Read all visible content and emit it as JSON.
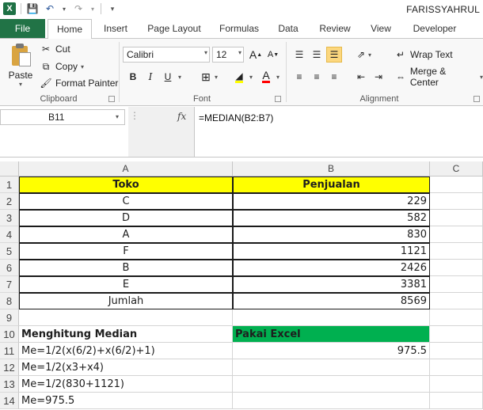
{
  "window": {
    "user": "FARISSYAHRUL",
    "qat_icons": [
      "excel-icon",
      "save-icon",
      "undo-icon",
      "redo-icon",
      "customize-icon"
    ]
  },
  "tabs": {
    "file": "File",
    "items": [
      "Home",
      "Insert",
      "Page Layout",
      "Formulas",
      "Data",
      "Review",
      "View",
      "Developer"
    ],
    "active": "Home"
  },
  "ribbon": {
    "clipboard": {
      "paste": "Paste",
      "cut": "Cut",
      "copy": "Copy",
      "format_painter": "Format Painter",
      "label": "Clipboard"
    },
    "font": {
      "font_name": "Calibri",
      "font_size": "12",
      "bold": "B",
      "italic": "I",
      "underline": "U",
      "label": "Font"
    },
    "alignment": {
      "wrap_text": "Wrap Text",
      "merge_center": "Merge & Center",
      "label": "Alignment"
    }
  },
  "formula_bar": {
    "name_box": "B11",
    "fx": "fx",
    "formula": "=MEDIAN(B2:B7)"
  },
  "sheet": {
    "columns": [
      "A",
      "B",
      "C"
    ],
    "rows": [
      "1",
      "2",
      "3",
      "4",
      "5",
      "6",
      "7",
      "8",
      "9",
      "10",
      "11",
      "12",
      "13",
      "14"
    ],
    "cells": {
      "A1": "Toko",
      "B1": "Penjualan",
      "A2": "C",
      "B2": "229",
      "A3": "D",
      "B3": "582",
      "A4": "A",
      "B4": "830",
      "A5": "F",
      "B5": "1121",
      "A6": "B",
      "B6": "2426",
      "A7": "E",
      "B7": "3381",
      "A8": "Jumlah",
      "B8": "8569",
      "A10": "Menghitung Median",
      "B10": "Pakai Excel",
      "A11": "Me=1/2(x(6/2)+x(6/2)+1)",
      "B11": "975.5",
      "A12": "Me=1/2(x3+x4)",
      "A13": "Me=1/2(830+1121)",
      "A14": "Me=975.5"
    },
    "colors": {
      "header_fill": "#ffff00",
      "excel_fill": "#00b050",
      "file_tab": "#217346"
    }
  }
}
